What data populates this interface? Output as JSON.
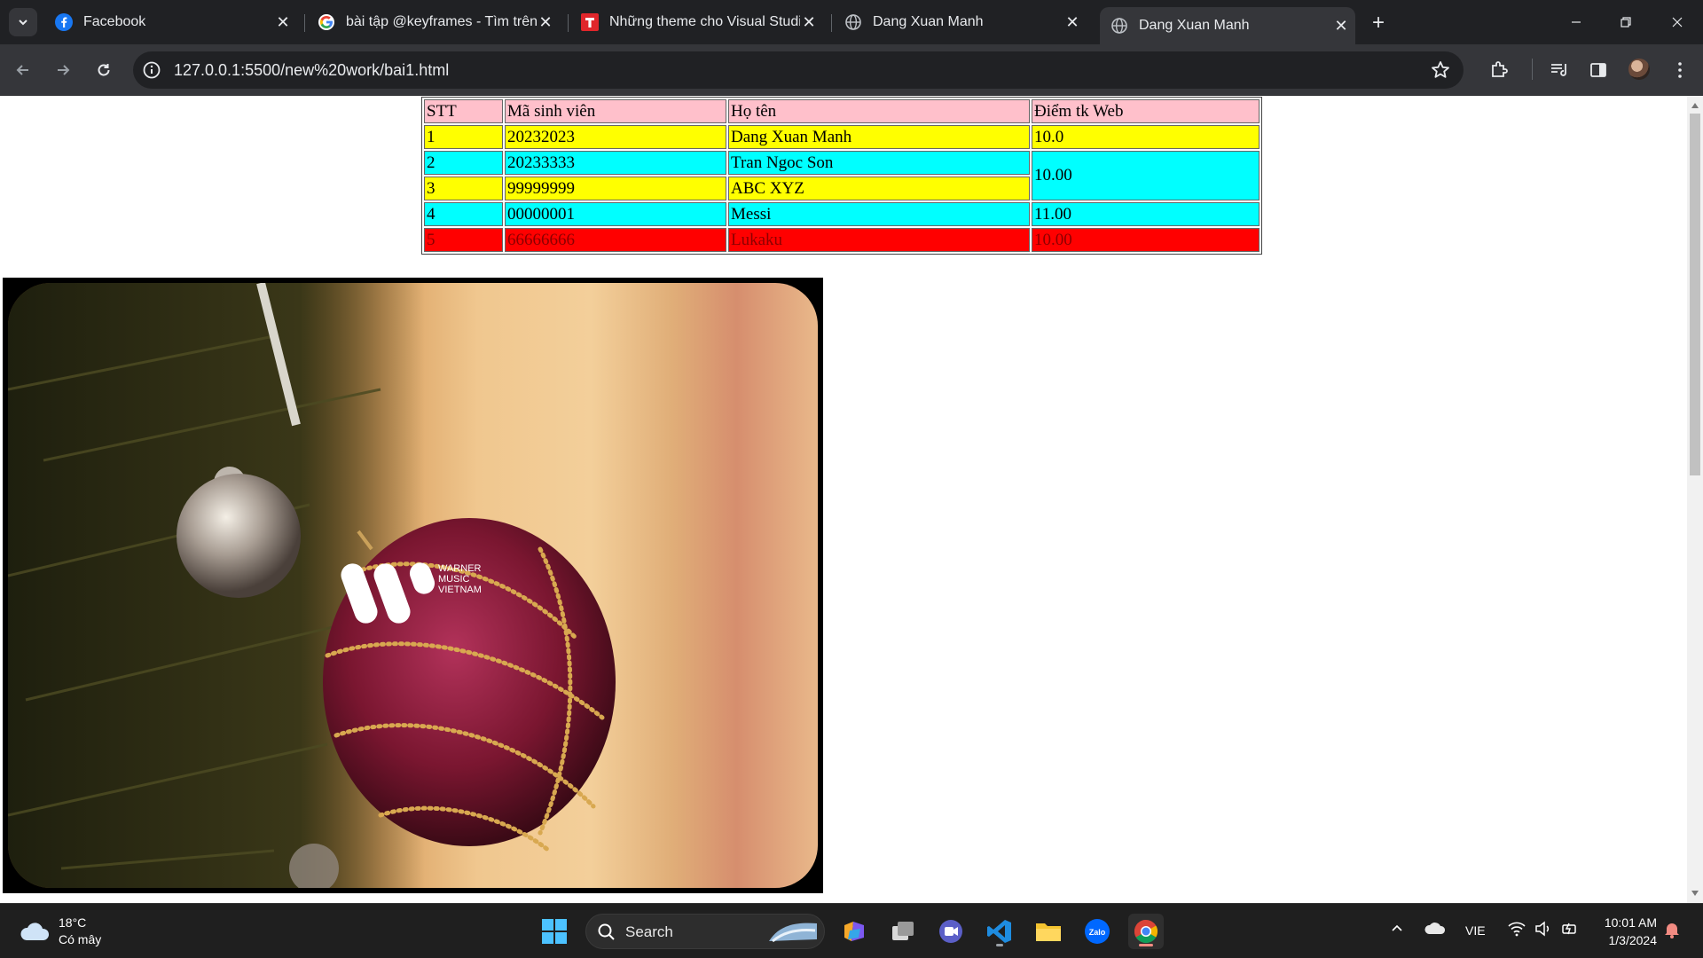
{
  "browser": {
    "tabs": [
      {
        "title": "Facebook",
        "icon": "facebook-icon",
        "active": false
      },
      {
        "title": "bài tập @keyframes - Tìm trên G",
        "icon": "google-icon",
        "active": false
      },
      {
        "title": "Những theme cho Visual Studio",
        "icon": "t-brand-icon",
        "active": false
      },
      {
        "title": "Dang Xuan Manh",
        "icon": "globe-icon",
        "active": false
      },
      {
        "title": "Dang Xuan Manh",
        "icon": "globe-icon",
        "active": true
      }
    ],
    "url": "127.0.0.1:5500/new%20work/bai1.html"
  },
  "page": {
    "table": {
      "headers": [
        "STT",
        "Mã sinh viên",
        "Họ tên",
        "Điểm tk Web"
      ],
      "rows": [
        {
          "stt": "1",
          "msv": "20232023",
          "name": "Dang Xuan Manh",
          "score": "10.0",
          "color": "yellow"
        },
        {
          "stt": "2",
          "msv": "20233333",
          "name": "Tran Ngoc Son",
          "score": "10.00",
          "color": "cyan"
        },
        {
          "stt": "3",
          "msv": "99999999",
          "name": "ABC XYZ",
          "score": "",
          "color": "yellow"
        },
        {
          "stt": "4",
          "msv": "00000001",
          "name": "Messi",
          "score": "11.00",
          "color": "cyan"
        },
        {
          "stt": "5",
          "msv": "66666666",
          "name": "Lukaku",
          "score": "10.00",
          "color": "red"
        }
      ]
    },
    "image": {
      "watermark": "WARNER MUSIC VIETNAM"
    }
  },
  "taskbar": {
    "weather": {
      "temp": "18°C",
      "desc": "Có mây"
    },
    "search_label": "Search",
    "language": "VIE",
    "time": "10:01 AM",
    "date": "1/3/2024"
  },
  "colors": {
    "pink": "#ffc0cb",
    "yellow": "#ffff00",
    "cyan": "#00ffff",
    "red": "#ff0000"
  }
}
